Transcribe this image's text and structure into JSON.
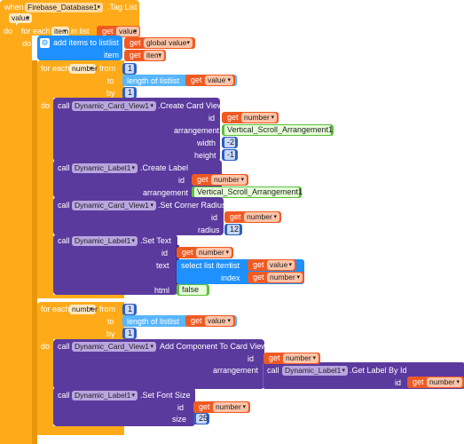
{
  "event": {
    "when": "when",
    "component": "Firebase_Database1",
    "event_name": ".Tag List",
    "param": "value",
    "do": "do"
  },
  "foreach_item": {
    "label": "for each",
    "var": "item",
    "in_list": "in list",
    "get": "get",
    "get_value": "value"
  },
  "add_items": {
    "do": "do",
    "label": "add items to list",
    "list_label": "list",
    "get": "get",
    "list_value": "global value",
    "item_label": "item",
    "item_value": "item"
  },
  "loop1": {
    "label": "for each",
    "var": "number",
    "from_label": "from",
    "from_value": "1",
    "to_label": "to",
    "length_label": "length of list",
    "list_label": "list",
    "get": "get",
    "get_value": "value",
    "by_label": "by",
    "by_value": "1",
    "do": "do"
  },
  "create_card": {
    "call": "call",
    "component": "Dynamic_Card_View1",
    "method": ".Create Card View",
    "id_label": "id",
    "get": "get",
    "id_value": "number",
    "arrangement_label": "arrangement",
    "arrangement_value": "Vertical_Scroll_Arrangement1",
    "width_label": "width",
    "width_value": "-2",
    "height_label": "height",
    "height_value": "-1"
  },
  "create_label": {
    "call": "call",
    "component": "Dynamic_Label1",
    "method": ".Create Label",
    "id_label": "id",
    "get": "get",
    "id_value": "number",
    "arrangement_label": "arrangement",
    "arrangement_value": "Vertical_Scroll_Arrangement1"
  },
  "corner_radius": {
    "call": "call",
    "component": "Dynamic_Card_View1",
    "method": ".Set Corner Radius",
    "id_label": "id",
    "get": "get",
    "id_value": "number",
    "radius_label": "radius",
    "radius_value": "12"
  },
  "set_text": {
    "call": "call",
    "component": "Dynamic_Label1",
    "method": ".Set Text",
    "id_label": "id",
    "get": "get",
    "id_value": "number",
    "text_label": "text",
    "select_label": "select list item",
    "list_label": "list",
    "list_value": "value",
    "index_label": "index",
    "index_value": "number",
    "html_label": "html",
    "html_value": "false"
  },
  "loop2": {
    "label": "for each",
    "var": "number",
    "from_label": "from",
    "from_value": "1",
    "to_label": "to",
    "length_label": "length of list",
    "list_label": "list",
    "get": "get",
    "get_value": "value",
    "by_label": "by",
    "by_value": "1",
    "do": "do"
  },
  "add_component": {
    "call": "call",
    "component": "Dynamic_Card_View1",
    "method": "Add Component To Card View",
    "id_label": "id",
    "get": "get",
    "id_value": "number",
    "arrangement_label": "arrangement",
    "inner_call": "call",
    "inner_component": "Dynamic_Label1",
    "inner_method": ".Get Label By Id",
    "inner_id_label": "id",
    "inner_id_value": "number"
  },
  "font_size": {
    "call": "call",
    "component": "Dynamic_Label1",
    "method": ".Set Font Size",
    "id_label": "id",
    "get": "get",
    "id_value": "number",
    "size_label": "size",
    "size_value": "25"
  },
  "colors": {
    "event": "#ffab19",
    "control": "#ffab19",
    "list": "#1e90ff",
    "procedure": "#5b3a9e",
    "getter": "#ef5a23",
    "number": "#2e5fbf",
    "logic": "#5bbf3d"
  }
}
